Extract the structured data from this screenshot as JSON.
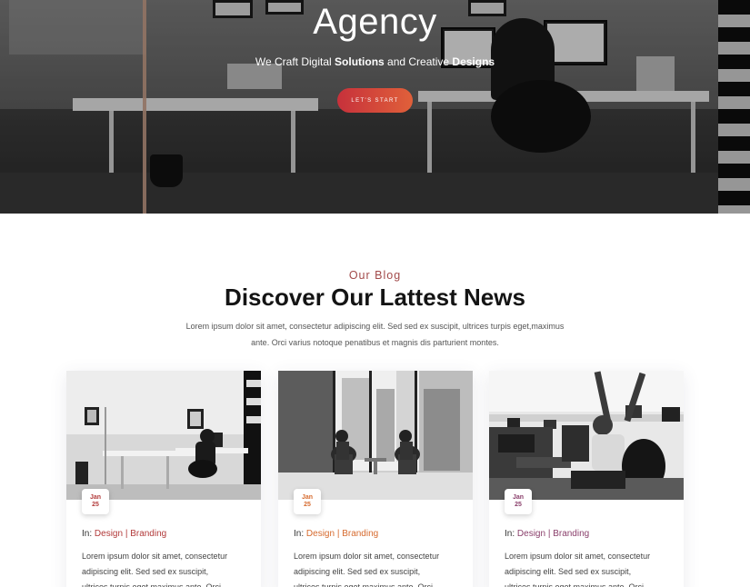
{
  "hero": {
    "title": "Agency",
    "subtitle_prefix": "We Craft Digital ",
    "subtitle_bold_1": "Solutions",
    "subtitle_middle": " and Creative ",
    "subtitle_bold_2": "Designs",
    "cta_label": "LET'S START",
    "cta_colors": [
      "#c7313b",
      "#e0603a"
    ]
  },
  "blog": {
    "label": "Our Blog",
    "title": "Discover Our Lattest News",
    "description_line1": "Lorem ipsum dolor sit amet, consectetur adipiscing elit. Sed sed ex suscipit, ultrices turpis eget,maximus",
    "description_line2": "ante. Orci varius notoque penatibus et magnis dis parturient montes.",
    "cards": [
      {
        "date_month": "Jan",
        "date_day": "25",
        "category_prefix": "In: ",
        "categories": "Design | Branding",
        "text_1": "Lorem ipsum dolor sit amet, consectetur",
        "text_2": "adipiscing elit. Sed sed ex suscipit,",
        "text_3": "ultrices turpis eget maximus ante. Orci",
        "accent": "#b23a3a"
      },
      {
        "date_month": "Jan",
        "date_day": "25",
        "category_prefix": "In: ",
        "categories": "Design | Branding",
        "text_1": "Lorem ipsum dolor sit amet, consectetur",
        "text_2": "adipiscing elit. Sed sed ex suscipit,",
        "text_3": "ultrices turpis eget maximus ante. Orci",
        "accent": "#d66a2e"
      },
      {
        "date_month": "Jan",
        "date_day": "25",
        "category_prefix": "In: ",
        "categories": "Design | Branding",
        "text_1": "Lorem ipsum dolor sit amet, consectetur",
        "text_2": "adipiscing elit. Sed sed ex suscipit,",
        "text_3": "ultrices turpis eget maximus ante. Orci",
        "accent": "#8a3f6b"
      }
    ]
  }
}
